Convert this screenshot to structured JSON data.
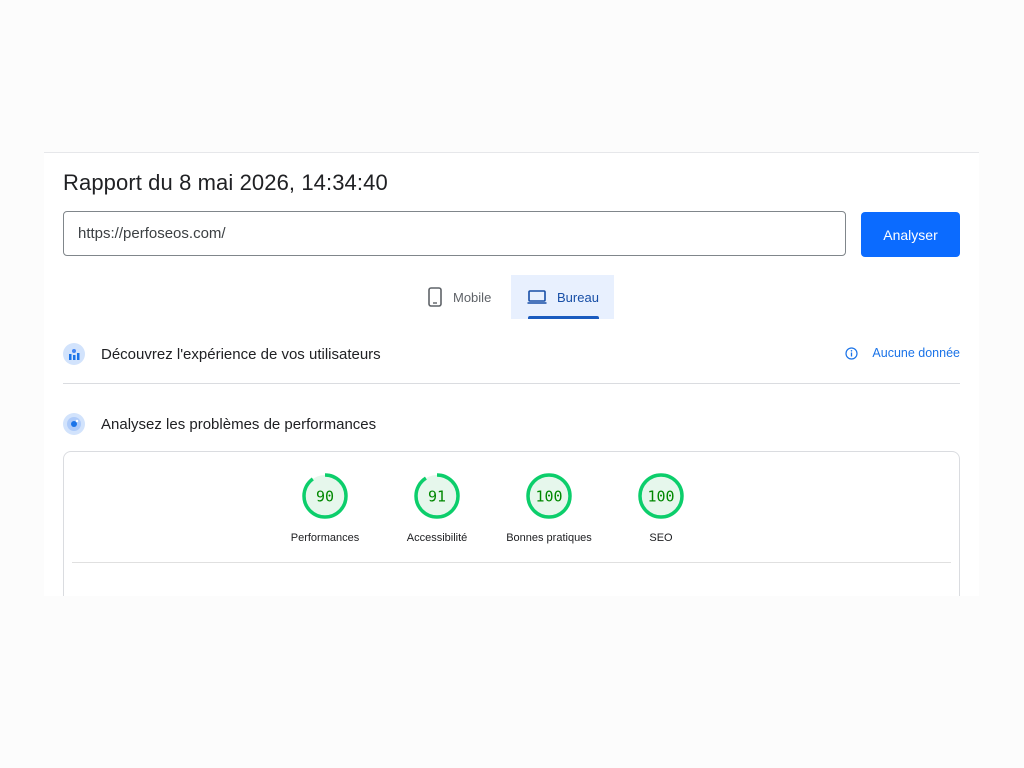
{
  "report": {
    "title": "Rapport du 8 mai 2026, 14:34:40"
  },
  "form": {
    "url_value": "https://perfoseos.com/",
    "analyze_label": "Analyser"
  },
  "tabs": [
    {
      "label": "Mobile",
      "icon": "smartphone-icon",
      "selected": false
    },
    {
      "label": "Bureau",
      "icon": "laptop-icon",
      "selected": true
    }
  ],
  "field_data": {
    "title": "Découvrez l'expérience de vos utilisateurs",
    "status": "Aucune donnée",
    "status_icon": "info-icon"
  },
  "lab_data": {
    "title": "Analysez les problèmes de performances"
  },
  "scores": [
    {
      "label": "Performances",
      "value": 90
    },
    {
      "label": "Accessibilité",
      "value": 91
    },
    {
      "label": "Bonnes pratiques",
      "value": 100
    },
    {
      "label": "SEO",
      "value": 100
    }
  ],
  "colors": {
    "accent": "#0b6bff",
    "pass": "#0cce6b",
    "pass_fill": "#e6f7ec",
    "pass_text": "#008800",
    "link": "#1a73e8"
  }
}
